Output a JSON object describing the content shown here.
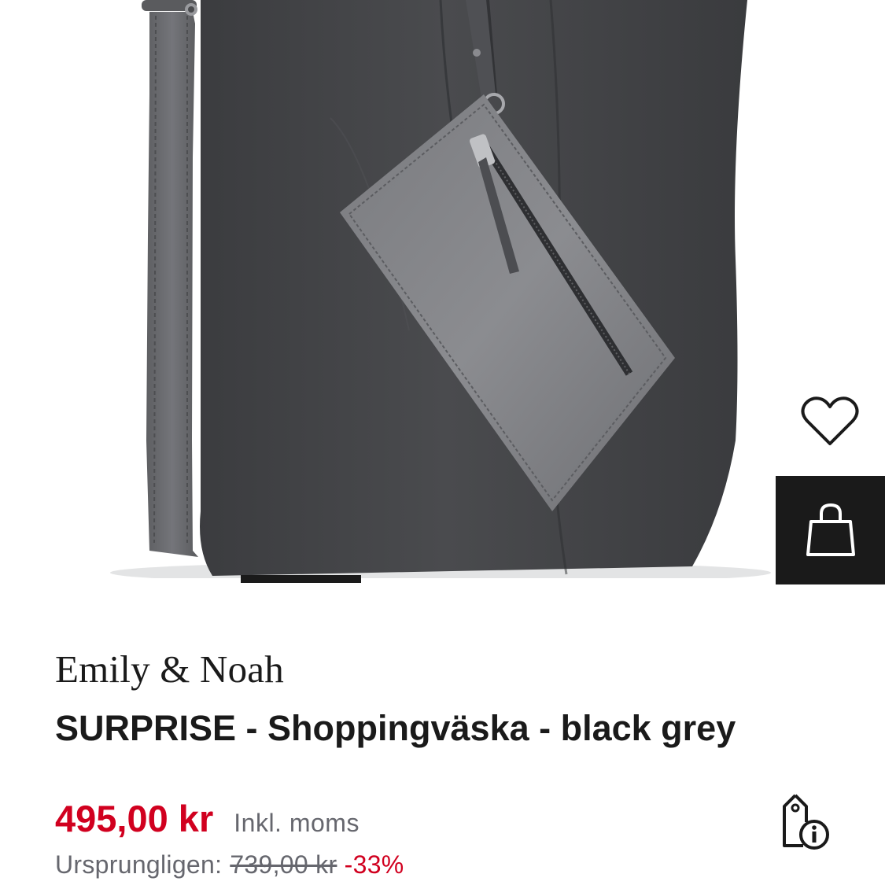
{
  "product": {
    "brand": "Emily & Noah",
    "name": "SURPRISE - Shoppingväska - black grey"
  },
  "pricing": {
    "current_price": "495,00 kr",
    "vat_note": "Inkl. moms",
    "original_label": "Ursprungligen:",
    "original_price": "739,00 kr",
    "discount": "-33%"
  },
  "icons": {
    "wishlist": "heart-icon",
    "add_to_bag": "shopping-bag-icon",
    "price_info": "price-tag-info-icon"
  },
  "colors": {
    "sale_red": "#d1001f",
    "text_dark": "#1a1a1a",
    "text_muted": "#66676e",
    "bag_button_bg": "#1a1a1a"
  }
}
